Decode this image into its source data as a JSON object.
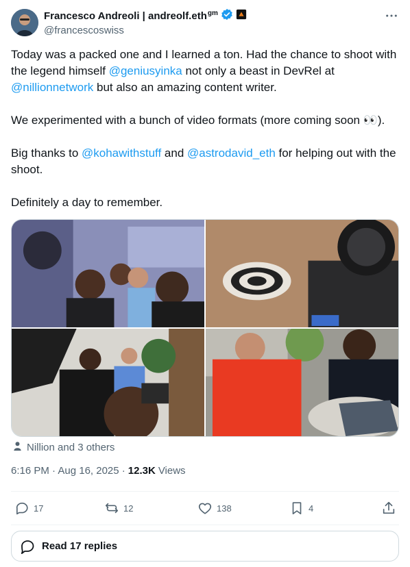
{
  "author": {
    "name": "Francesco Andreoli | andreolf.eth",
    "name_suffix": "gm",
    "handle": "@francescoswiss",
    "verified_color": "#1d9bf0"
  },
  "tweet": {
    "line1_prefix": "Today was a packed one and I learned a ton. Had the chance to shoot with the legend himself ",
    "mention_1": "@geniusyinka",
    "line1_middle": " not only a beast in DevRel at ",
    "mention_2": "@nillionnetwork",
    "line1_suffix": " but also an amazing content writer.",
    "para2": "We experimented with a bunch of video formats (more coming soon 👀).",
    "para3_prefix": "Big thanks to ",
    "mention_3": "@kohawithstuff",
    "para3_middle": " and ",
    "mention_4": "@astrodavid_eth",
    "para3_suffix": " for helping out with the shoot.",
    "para4": "Definitely a day to remember."
  },
  "tagged": "Nillion and 3 others",
  "meta": {
    "time": "6:16 PM · Aug 16, 2025 ·",
    "views_count": "12.3K",
    "views_label": "Views"
  },
  "actions": {
    "replies": "17",
    "reposts": "12",
    "likes": "138",
    "bookmarks": "4"
  },
  "read_replies": "Read 17 replies",
  "colors": {
    "link": "#1d9bf0",
    "secondary_text": "#536471",
    "border": "#cfd9de"
  },
  "icons": [
    "more-icon",
    "verified-badge-icon",
    "affiliate-badge-icon",
    "person-icon",
    "reply-icon",
    "repost-icon",
    "like-icon",
    "bookmark-icon",
    "share-icon",
    "speech-bubble-icon"
  ]
}
